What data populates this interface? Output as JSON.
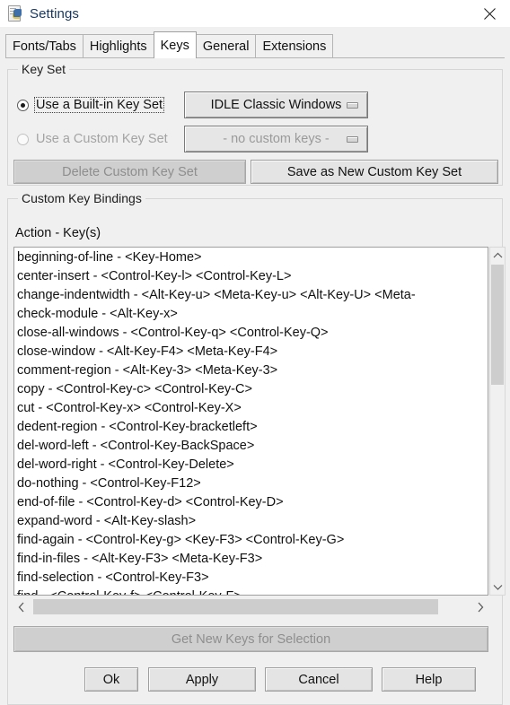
{
  "window": {
    "title": "Settings",
    "icon": "python-idle-document-icon",
    "close_label": "✕"
  },
  "tabs": [
    {
      "label": "Fonts/Tabs",
      "active": false
    },
    {
      "label": "Highlights",
      "active": false
    },
    {
      "label": "Keys",
      "active": true
    },
    {
      "label": "General",
      "active": false
    },
    {
      "label": "Extensions",
      "active": false
    }
  ],
  "key_set": {
    "group_title": "Key Set",
    "builtin": {
      "radio_label": "Use a Built-in Key Set",
      "selected": true,
      "focused": true,
      "dropdown_value": "IDLE Classic Windows",
      "dropdown_enabled": true
    },
    "custom": {
      "radio_label": "Use a Custom Key Set",
      "selected": false,
      "enabled": false,
      "dropdown_value": "- no custom keys -",
      "dropdown_enabled": false
    },
    "delete_button": {
      "label": "Delete Custom Key Set",
      "enabled": false
    },
    "save_button": {
      "label": "Save as New Custom Key Set",
      "enabled": true
    }
  },
  "bindings": {
    "group_title": "Custom Key Bindings",
    "column_header": "Action - Key(s)",
    "rows": [
      "beginning-of-line - <Key-Home>",
      "center-insert - <Control-Key-l> <Control-Key-L>",
      "change-indentwidth - <Alt-Key-u> <Meta-Key-u> <Alt-Key-U> <Meta-",
      "check-module - <Alt-Key-x>",
      "close-all-windows - <Control-Key-q> <Control-Key-Q>",
      "close-window - <Alt-Key-F4> <Meta-Key-F4>",
      "comment-region - <Alt-Key-3> <Meta-Key-3>",
      "copy - <Control-Key-c> <Control-Key-C>",
      "cut - <Control-Key-x> <Control-Key-X>",
      "dedent-region - <Control-Key-bracketleft>",
      "del-word-left - <Control-Key-BackSpace>",
      "del-word-right - <Control-Key-Delete>",
      "do-nothing - <Control-Key-F12>",
      "end-of-file - <Control-Key-d> <Control-Key-D>",
      "expand-word - <Alt-Key-slash>",
      "find-again - <Control-Key-g> <Key-F3> <Control-Key-G>",
      "find-in-files - <Alt-Key-F3> <Meta-Key-F3>",
      "find-selection - <Control-Key-F3>",
      "find - <Control-Key-f> <Control-Key-F>"
    ],
    "get_keys_button": {
      "label": "Get New Keys for Selection",
      "enabled": false
    },
    "vscroll": {
      "up_icon": "chevron-up-icon",
      "down_icon": "chevron-down-icon"
    },
    "hscroll": {
      "left_icon": "chevron-left-icon",
      "right_icon": "chevron-right-icon"
    }
  },
  "dialog_buttons": [
    {
      "label": "Ok"
    },
    {
      "label": "Apply"
    },
    {
      "label": "Cancel"
    },
    {
      "label": "Help"
    }
  ],
  "colors": {
    "window_bg": "#f0f0f0",
    "titlebar_bg": "#ffffff",
    "title_text": "#17365d",
    "list_bg": "#ffffff",
    "scroll_thumb": "#cdcdcd",
    "disabled_text": "#9a9a9a"
  }
}
